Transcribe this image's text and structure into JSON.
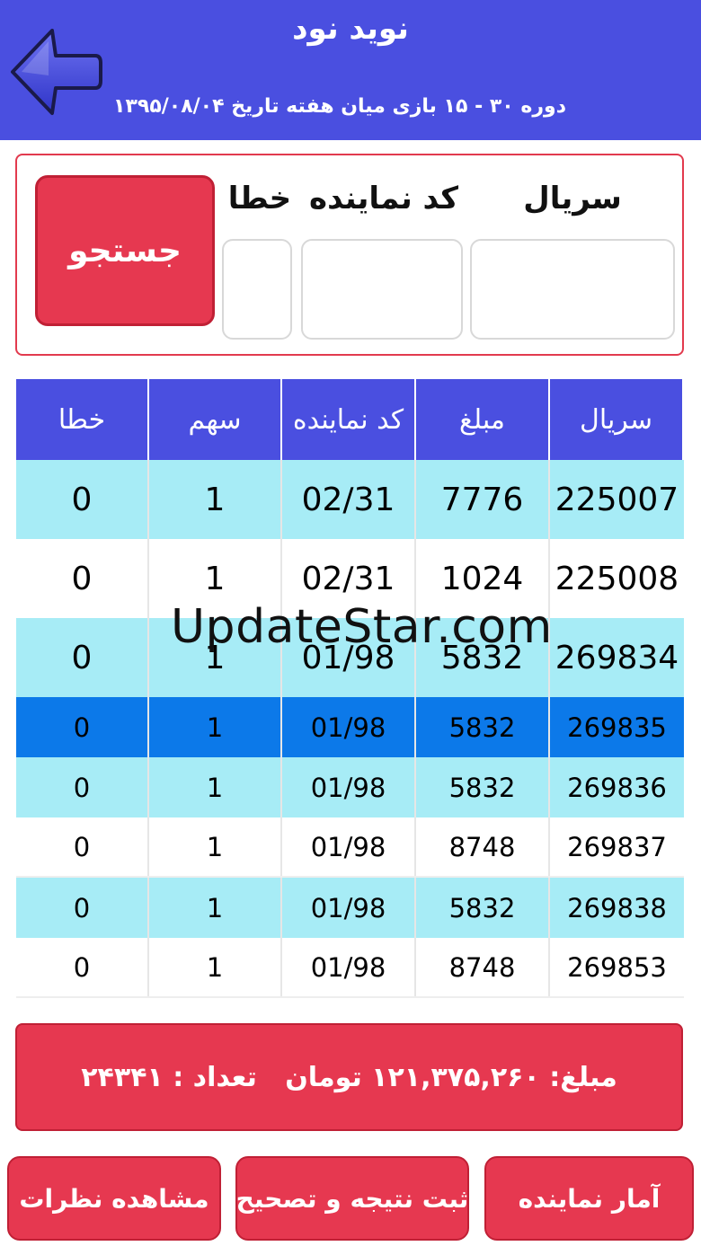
{
  "header": {
    "title": "نوید نود",
    "subtitle": "دوره ۳۰ - ۱۵ بازی میان هفته تاریخ ۱۳۹۵/۰۸/۰۴",
    "back_icon": "arrow-left-icon",
    "color": "#4a4fe0"
  },
  "search": {
    "serial_label": "سریال",
    "agent_code_label": "کد نماینده",
    "error_label": "خطا",
    "button_label": "جستجو",
    "serial_value": "",
    "agent_code_value": "",
    "error_value": ""
  },
  "table": {
    "columns": [
      "سریال",
      "مبلغ",
      "کد نماینده",
      "سهم",
      "خطا"
    ],
    "rows": [
      {
        "serial": "225007",
        "amount": "7776",
        "agent_code": "02/31",
        "share": "1",
        "error": "0"
      },
      {
        "serial": "225008",
        "amount": "1024",
        "agent_code": "02/31",
        "share": "1",
        "error": "0"
      },
      {
        "serial": "269834",
        "amount": "5832",
        "agent_code": "01/98",
        "share": "1",
        "error": "0"
      },
      {
        "serial": "269835",
        "amount": "5832",
        "agent_code": "01/98",
        "share": "1",
        "error": "0"
      },
      {
        "serial": "269836",
        "amount": "5832",
        "agent_code": "01/98",
        "share": "1",
        "error": "0"
      },
      {
        "serial": "269837",
        "amount": "8748",
        "agent_code": "01/98",
        "share": "1",
        "error": "0"
      },
      {
        "serial": "269838",
        "amount": "5832",
        "agent_code": "01/98",
        "share": "1",
        "error": "0"
      },
      {
        "serial": "269853",
        "amount": "8748",
        "agent_code": "01/98",
        "share": "1",
        "error": "0"
      }
    ],
    "colors": {
      "header": "#4a4fe0",
      "cyan": "#a7ecf6",
      "selected": "#0c79e9"
    }
  },
  "summary": {
    "text": "مبلغ: ۱۲۱,۳۷۵,۲۶۰ تومان   تعداد : ۲۴۳۴۱"
  },
  "actions": {
    "agent_stats": "آمار نماینده",
    "submit_result": "ثبت نتیجه و تصحیح",
    "view_comments": "مشاهده نظرات"
  },
  "watermark": "UpdateStar.com",
  "accent": "#e63850"
}
